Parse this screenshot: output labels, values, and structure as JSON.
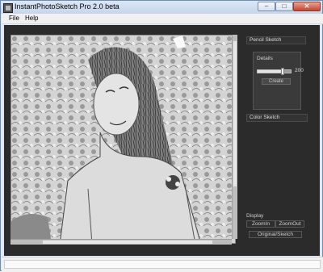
{
  "window": {
    "title": "InstantPhotoSketch Pro 2.0 beta",
    "minimize_glyph": "–",
    "maximize_glyph": "□",
    "close_glyph": "✕"
  },
  "menu": {
    "file": "File",
    "help": "Help"
  },
  "panel": {
    "pencil_sketch": "Pencil Sketch",
    "details_title": "Details",
    "details_value": "200",
    "details_level": 0.78,
    "create_label": "Create",
    "color_sketch": "Color Sketch",
    "display_label": "Display",
    "zoom_in": "ZoomIn",
    "zoom_out": "ZoomOut",
    "original_sketch": "Original/Sketch"
  },
  "icons": {
    "app": "app-icon",
    "minimize": "minimize-icon",
    "maximize": "maximize-icon",
    "close": "close-icon"
  },
  "colors": {
    "workspace_bg": "#2b2b2b",
    "panel_bg": "#3a3a3a",
    "titlebar": "#c4d6ec",
    "close_button": "#c5442e"
  }
}
